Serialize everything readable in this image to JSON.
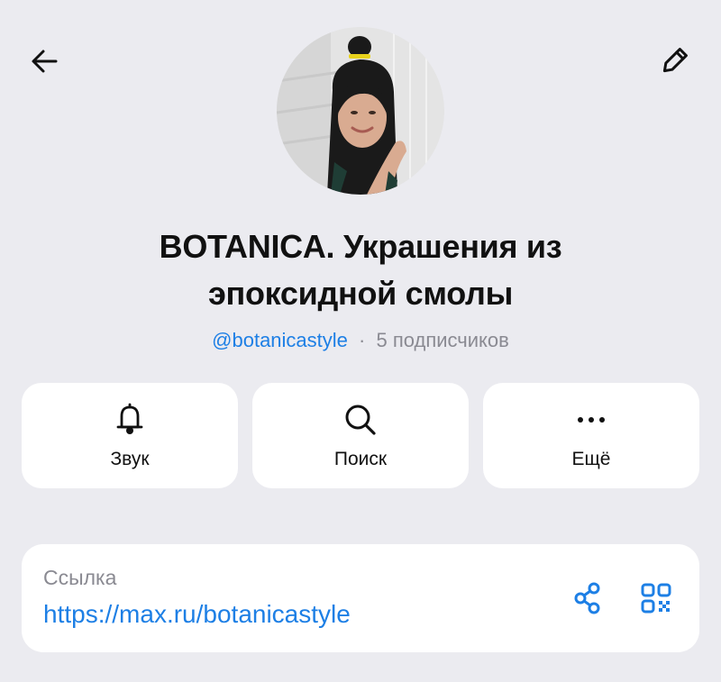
{
  "header": {
    "back_icon": "arrow-left-icon",
    "edit_icon": "pencil-icon"
  },
  "profile": {
    "title_line1": "BOTANICA. Украшения из",
    "title_line2": "эпоксидной смолы",
    "handle": "@botanicastyle",
    "separator": "·",
    "subscribers": "5 подписчиков"
  },
  "actions": [
    {
      "label": "Звук",
      "icon": "bell-icon"
    },
    {
      "label": "Поиск",
      "icon": "search-icon"
    },
    {
      "label": "Ещё",
      "icon": "more-dots-icon"
    }
  ],
  "link": {
    "label": "Ссылка",
    "url": "https://max.ru/botanicastyle",
    "share_icon": "share-icon",
    "qr_icon": "qr-code-icon"
  },
  "colors": {
    "background": "#ebebf0",
    "card": "#ffffff",
    "accent": "#1d7fe5",
    "text": "#111111",
    "muted": "#8a8a92"
  }
}
